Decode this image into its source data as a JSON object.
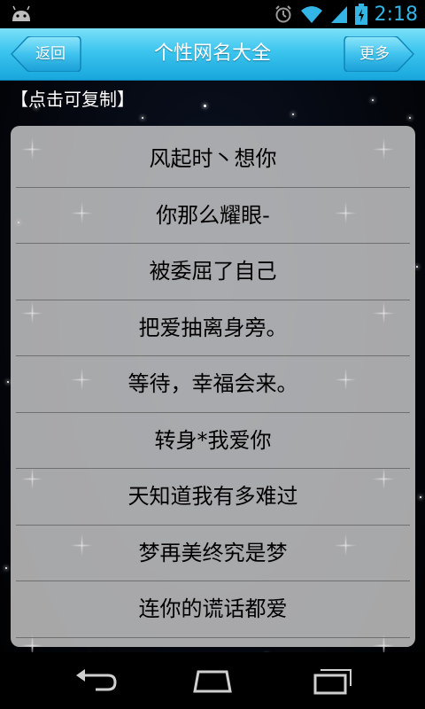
{
  "status_bar": {
    "time": "2:18",
    "icons": [
      "android-icon",
      "alarm-icon",
      "wifi-icon",
      "signal-icon",
      "battery-charging-icon"
    ],
    "accent_color": "#33b5e5"
  },
  "header": {
    "back_label": "返回",
    "title": "个性网名大全",
    "more_label": "更多",
    "bar_color": "#3bc4ee"
  },
  "hint": "【点击可复制】",
  "list": {
    "items": [
      "风起时丶想你",
      "你那么耀眼-",
      "被委屈了自己",
      "把爱抽离身旁。",
      "等待，幸福会来。",
      "转身*我爱你",
      "天知道我有多难过",
      "梦再美终究是梦",
      "连你的谎话都爱"
    ]
  },
  "nav_bar": {
    "icons": [
      "back-nav-icon",
      "home-nav-icon",
      "recent-apps-icon"
    ]
  }
}
